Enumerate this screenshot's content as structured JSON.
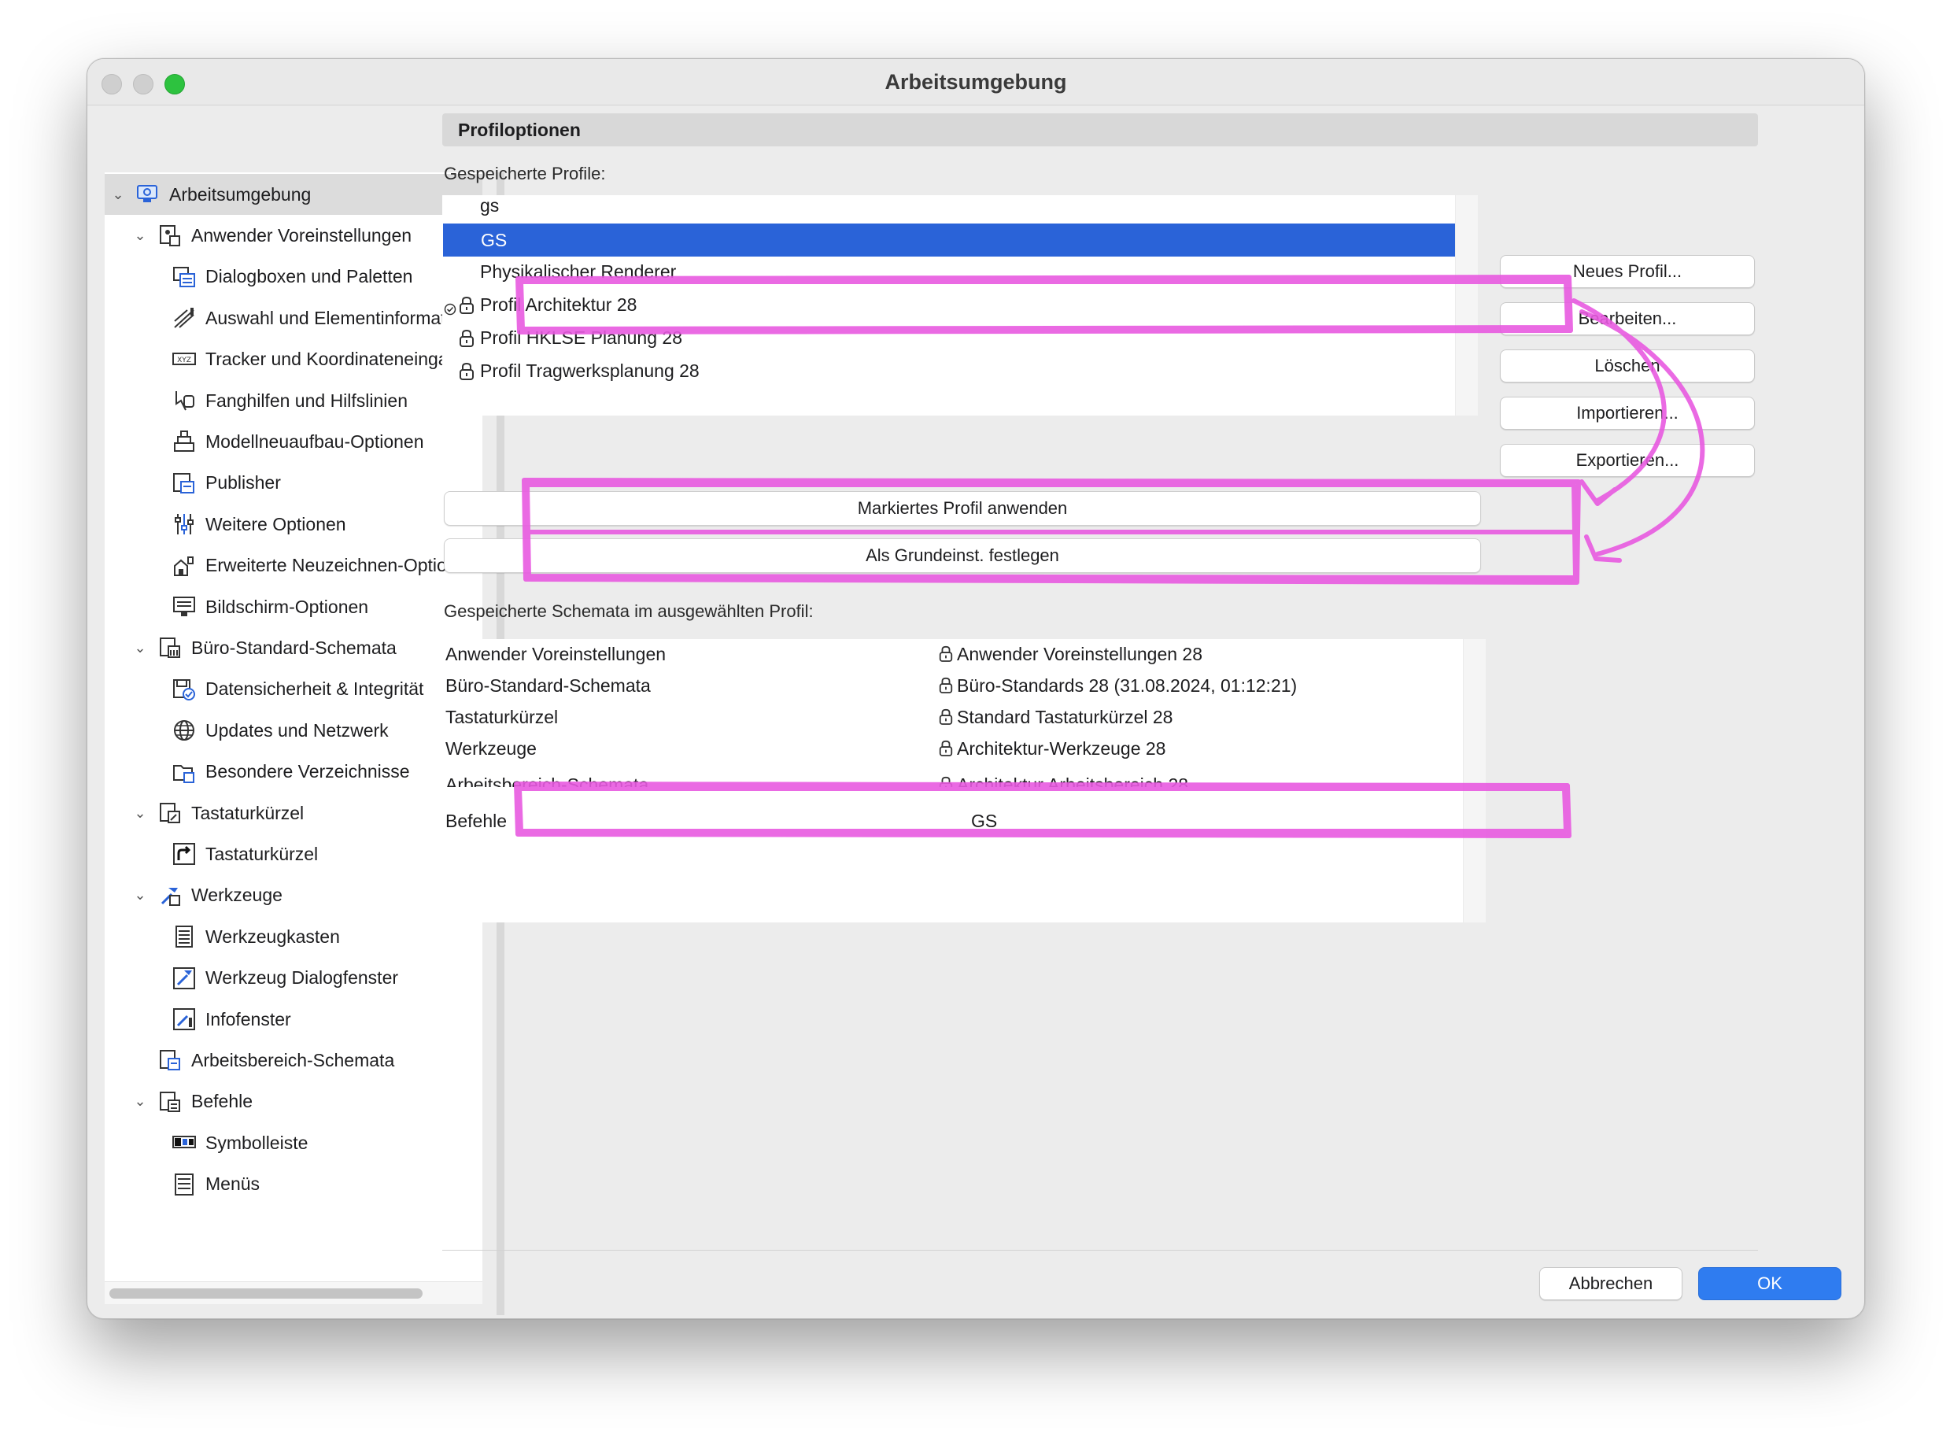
{
  "window": {
    "title": "Arbeitsumgebung"
  },
  "sidebar": {
    "items": [
      {
        "label": "Arbeitsumgebung",
        "level": 0,
        "expanded": true,
        "selected": true,
        "icon": "workspace-icon"
      },
      {
        "label": "Anwender Voreinstellungen",
        "level": 1,
        "expanded": true,
        "icon": "user-settings-icon"
      },
      {
        "label": "Dialogboxen und Paletten",
        "level": 2,
        "icon": "dialog-palette-icon"
      },
      {
        "label": "Auswahl und Elementinformation",
        "level": 2,
        "icon": "selection-info-icon"
      },
      {
        "label": "Tracker und Koordinateneingabe",
        "level": 2,
        "icon": "xyz-tracker-icon"
      },
      {
        "label": "Fanghilfen und Hilfslinien",
        "level": 2,
        "icon": "snap-guides-icon"
      },
      {
        "label": "Modellneuaufbau-Optionen",
        "level": 2,
        "icon": "rebuild-icon"
      },
      {
        "label": "Publisher",
        "level": 2,
        "icon": "publisher-icon"
      },
      {
        "label": "Weitere Optionen",
        "level": 2,
        "icon": "sliders-icon"
      },
      {
        "label": "Erweiterte Neuzeichnen-Optione",
        "level": 2,
        "icon": "redraw-icon"
      },
      {
        "label": "Bildschirm-Optionen",
        "level": 2,
        "icon": "monitor-icon"
      },
      {
        "label": "Büro-Standard-Schemata",
        "level": 1,
        "expanded": true,
        "icon": "office-standard-icon"
      },
      {
        "label": "Datensicherheit & Integrität",
        "level": 2,
        "icon": "data-safety-icon"
      },
      {
        "label": "Updates und Netzwerk",
        "level": 2,
        "icon": "globe-icon"
      },
      {
        "label": "Besondere Verzeichnisse",
        "level": 2,
        "icon": "folder-icon"
      },
      {
        "label": "Tastaturkürzel",
        "level": 1,
        "expanded": true,
        "icon": "shortcut-scheme-icon"
      },
      {
        "label": "Tastaturkürzel",
        "level": 2,
        "icon": "shortcut-arrow-icon"
      },
      {
        "label": "Werkzeuge",
        "level": 1,
        "expanded": true,
        "icon": "tools-scheme-icon"
      },
      {
        "label": "Werkzeugkasten",
        "level": 2,
        "icon": "toolbox-icon"
      },
      {
        "label": "Werkzeug Dialogfenster",
        "level": 2,
        "icon": "tool-dialog-icon"
      },
      {
        "label": "Infofenster",
        "level": 2,
        "icon": "info-window-icon"
      },
      {
        "label": "Arbeitsbereich-Schemata",
        "level": 1,
        "icon": "workspace-scheme-icon"
      },
      {
        "label": "Befehle",
        "level": 1,
        "expanded": true,
        "icon": "commands-scheme-icon"
      },
      {
        "label": "Symbolleiste",
        "level": 2,
        "icon": "toolbar-icon"
      },
      {
        "label": "Menüs",
        "level": 2,
        "icon": "menus-icon"
      }
    ]
  },
  "main": {
    "section_title": "Profiloptionen",
    "saved_profiles_label": "Gespeicherte Profile:",
    "profiles": [
      {
        "name": "gs",
        "locked": false,
        "selected": false
      },
      {
        "name": "GS",
        "locked": false,
        "selected": true
      },
      {
        "name": "Physikalischer Renderer",
        "locked": false,
        "selected": false
      },
      {
        "name": "Profil Architektur 28",
        "locked": true,
        "default": true,
        "selected": false
      },
      {
        "name": "Profil HKLSE Planung 28",
        "locked": true,
        "selected": false
      },
      {
        "name": "Profil Tragwerksplanung 28",
        "locked": true,
        "selected": false
      }
    ],
    "side_buttons": {
      "new": "Neues Profil...",
      "edit": "Bearbeiten...",
      "delete": "Löschen",
      "import": "Importieren...",
      "export": "Exportieren..."
    },
    "apply_button": "Markiertes Profil anwenden",
    "default_button": "Als Grundeinst. festlegen",
    "schemata_label": "Gespeicherte Schemata im ausgewählten Profil:",
    "schemata": [
      {
        "scheme": "Anwender Voreinstellungen",
        "value": "Anwender Voreinstellungen 28",
        "locked": true
      },
      {
        "scheme": "Büro-Standard-Schemata",
        "value": "Büro-Standards 28  (31.08.2024, 01:12:21)",
        "locked": true
      },
      {
        "scheme": "Tastaturkürzel",
        "value": "Standard Tastaturkürzel 28",
        "locked": true
      },
      {
        "scheme": "Werkzeuge",
        "value": "Architektur-Werkzeuge 28",
        "locked": true
      },
      {
        "scheme": "Arbeitsbereich-Schemata",
        "value": "Architektur Arbeitsbereich 28",
        "locked": true
      },
      {
        "scheme": "Befehle",
        "value": "GS",
        "locked": false
      }
    ]
  },
  "footer": {
    "cancel": "Abbrechen",
    "ok": "OK"
  },
  "colors": {
    "selection": "#2a63d8",
    "accent": "#2f7cf0",
    "annotation": "#e85ae0"
  }
}
